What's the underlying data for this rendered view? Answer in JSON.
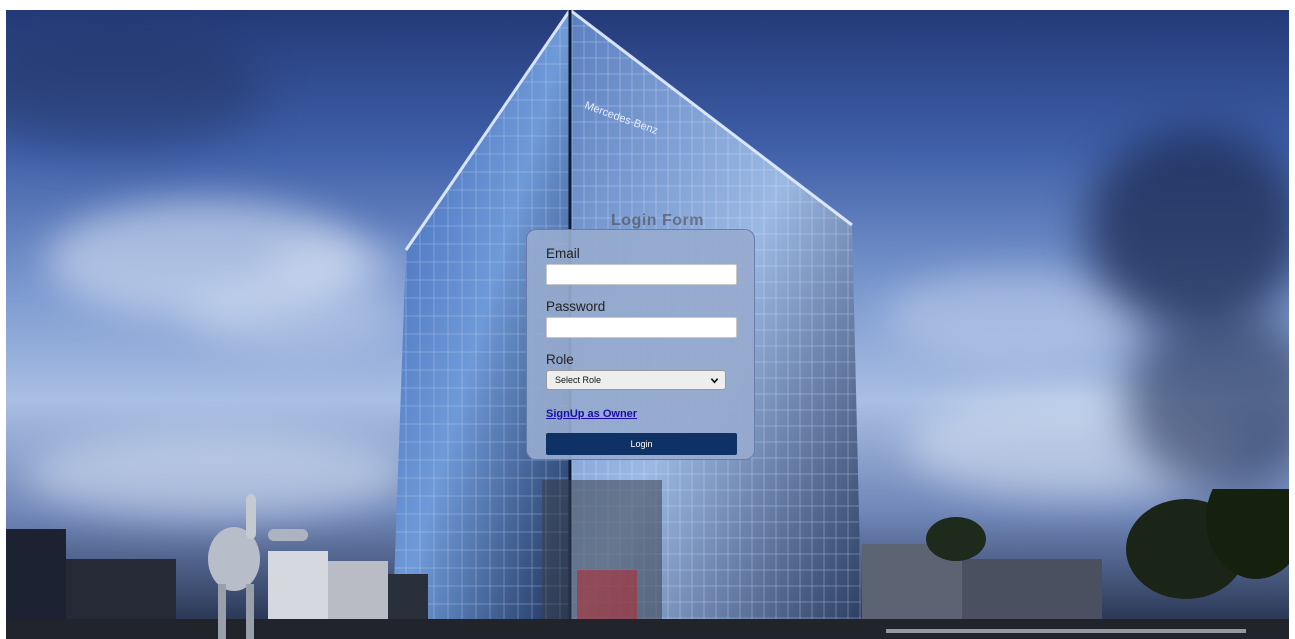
{
  "page": {
    "heading": "Login Form"
  },
  "form": {
    "email_label": "Email",
    "email_value": "",
    "password_label": "Password",
    "password_value": "",
    "role_label": "Role",
    "role_selected": "Select Role",
    "signup_link": "SignUp as Owner",
    "login_button": "Login"
  },
  "colors": {
    "card_background": "#96aacd",
    "button_background": "#0f3266",
    "link_color": "#1a0dab"
  },
  "background": {
    "building_sign": "Mercedes-Benz"
  }
}
